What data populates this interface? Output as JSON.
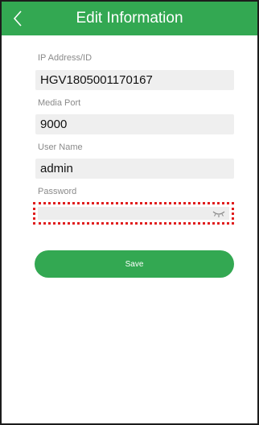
{
  "header": {
    "title": "Edit Information",
    "back_icon": "chevron-left-icon",
    "color": "#33a852"
  },
  "form": {
    "ip": {
      "label": "IP Address/ID",
      "value": "HGV1805001170167"
    },
    "port": {
      "label": "Media Port",
      "value": "9000"
    },
    "username": {
      "label": "User Name",
      "value": "admin"
    },
    "password": {
      "label": "Password",
      "value": "",
      "toggle_icon": "eye-closed-icon"
    }
  },
  "save_button": {
    "label": "Save",
    "color": "#33a852"
  },
  "highlight_color": "#e01e1e"
}
